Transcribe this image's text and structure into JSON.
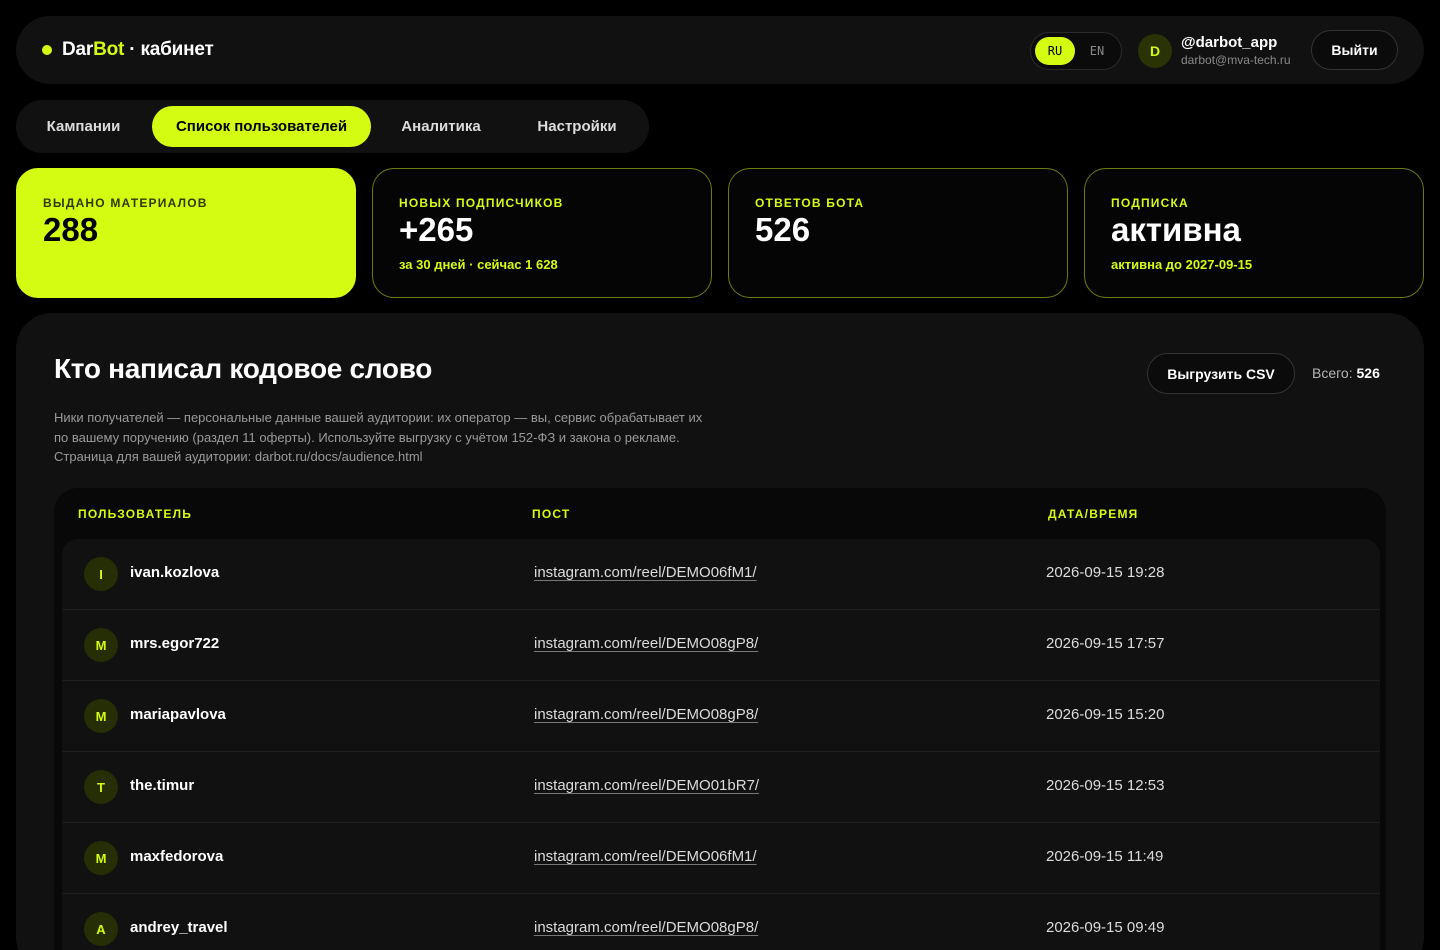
{
  "colors": {
    "accent": "#d4fc13",
    "background": "#000000",
    "surface": "#111111"
  },
  "header": {
    "logo_prefix": "Dar",
    "logo_accent": "Bot",
    "logo_suffix": " · кабинет",
    "lang": {
      "ru": "RU",
      "en": "EN",
      "selected": "RU"
    },
    "user": {
      "initial": "D",
      "handle": "@darbot_app",
      "email": "darbot@mva-tech.ru"
    },
    "logout_label": "Выйти"
  },
  "tabs": [
    {
      "label": "Кампании",
      "active": false
    },
    {
      "label": "Список пользователей",
      "active": true
    },
    {
      "label": "Аналитика",
      "active": false
    },
    {
      "label": "Настройки",
      "active": false
    }
  ],
  "stats": [
    {
      "label": "ВЫДАНО МАТЕРИАЛОВ",
      "value": "288",
      "sub": ""
    },
    {
      "label": "НОВЫХ ПОДПИСЧИКОВ",
      "value": "+265",
      "sub": "за 30 дней · сейчас 1 628"
    },
    {
      "label": "ОТВЕТОВ БОТА",
      "value": "526",
      "sub": ""
    },
    {
      "label": "ПОДПИСКА",
      "value": "активна",
      "sub": "активна до 2027-09-15"
    }
  ],
  "panel": {
    "title": "Кто написал кодовое слово",
    "export_label": "Выгрузить CSV",
    "total_label": "Всего:",
    "total_value": "526",
    "notice": "Ники получателей — персональные данные вашей аудитории: их оператор — вы, сервис обрабатывает их по вашему поручению (раздел 11 оферты). Используйте выгрузку с учётом 152-ФЗ и закона о рекламе. Страница для вашей аудитории: darbot.ru/docs/audience.html"
  },
  "table": {
    "headers": {
      "user": "ПОЛЬЗОВАТЕЛЬ",
      "post": "ПОСТ",
      "datetime": "ДАТА/ВРЕМЯ"
    },
    "rows": [
      {
        "initial": "I",
        "user": "ivan.kozlova",
        "post": "instagram.com/reel/DEMO06fM1/",
        "datetime": "2026-09-15 19:28"
      },
      {
        "initial": "M",
        "user": "mrs.egor722",
        "post": "instagram.com/reel/DEMO08gP8/",
        "datetime": "2026-09-15 17:57"
      },
      {
        "initial": "M",
        "user": "mariapavlova",
        "post": "instagram.com/reel/DEMO08gP8/",
        "datetime": "2026-09-15 15:20"
      },
      {
        "initial": "T",
        "user": "the.timur",
        "post": "instagram.com/reel/DEMO01bR7/",
        "datetime": "2026-09-15 12:53"
      },
      {
        "initial": "M",
        "user": "maxfedorova",
        "post": "instagram.com/reel/DEMO06fM1/",
        "datetime": "2026-09-15 11:49"
      },
      {
        "initial": "A",
        "user": "andrey_travel",
        "post": "instagram.com/reel/DEMO08gP8/",
        "datetime": "2026-09-15 09:49"
      }
    ]
  }
}
